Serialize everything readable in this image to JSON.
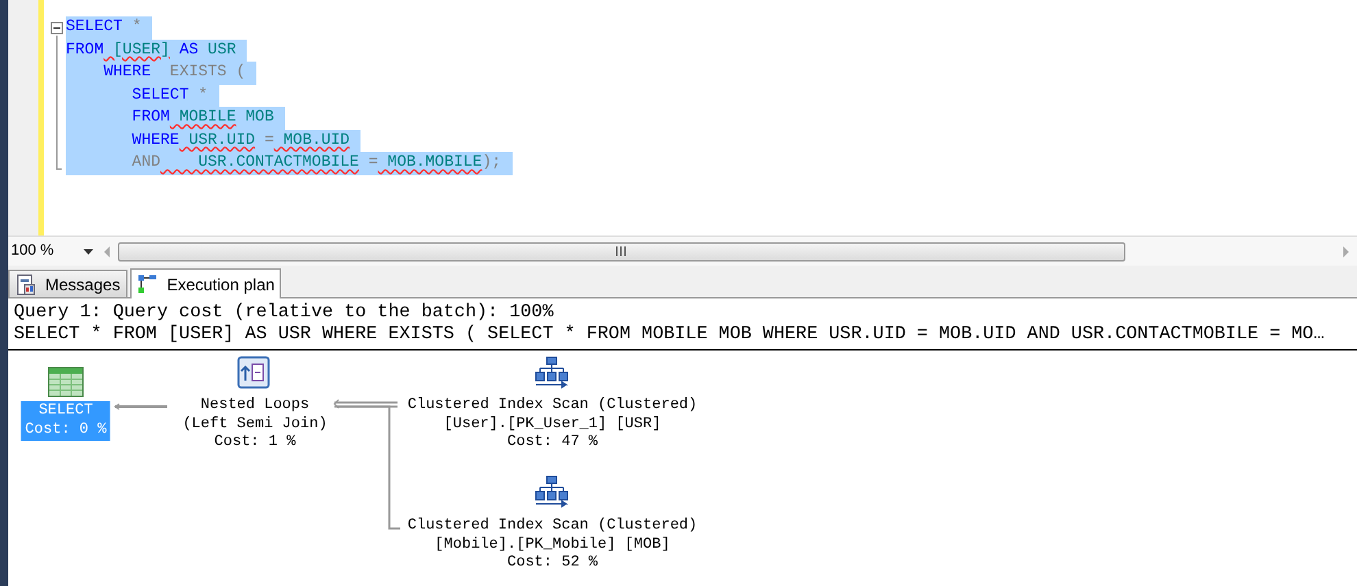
{
  "editor": {
    "selected": true,
    "lines": [
      [
        {
          "text": "SELECT",
          "kind": "keyword"
        },
        {
          "text": " *",
          "kind": "gray"
        }
      ],
      [
        {
          "text": "FROM",
          "kind": "keyword"
        },
        {
          "text": " [USER]",
          "kind": "ident",
          "squiggle": true
        },
        {
          "text": " AS",
          "kind": "keyword"
        },
        {
          "text": " USR",
          "kind": "ident"
        }
      ],
      [
        {
          "text": "    WHERE",
          "kind": "keyword"
        },
        {
          "text": "  EXISTS",
          "kind": "gray"
        },
        {
          "text": " (",
          "kind": "gray"
        }
      ],
      [
        {
          "text": "       SELECT",
          "kind": "keyword"
        },
        {
          "text": " *",
          "kind": "gray"
        }
      ],
      [
        {
          "text": "       FROM",
          "kind": "keyword"
        },
        {
          "text": " MOBILE",
          "kind": "ident",
          "squiggle": true
        },
        {
          "text": " MOB",
          "kind": "ident"
        }
      ],
      [
        {
          "text": "       WHERE",
          "kind": "keyword"
        },
        {
          "text": " USR.UID",
          "kind": "ident",
          "squiggle": true
        },
        {
          "text": " =",
          "kind": "gray"
        },
        {
          "text": " MOB.UID",
          "kind": "ident",
          "squiggle": true
        }
      ],
      [
        {
          "text": "       AND",
          "kind": "gray"
        },
        {
          "text": "    USR.CONTACTMOBILE",
          "kind": "ident",
          "squiggle": true
        },
        {
          "text": " =",
          "kind": "gray"
        },
        {
          "text": " MOB.MOBILE",
          "kind": "ident",
          "squiggle": true
        },
        {
          "text": ");",
          "kind": "gray"
        }
      ]
    ]
  },
  "zoom": {
    "value": "100 %"
  },
  "tabs": [
    {
      "label": "Messages",
      "kind": "messages",
      "selected": false
    },
    {
      "label": "Execution plan",
      "kind": "plan",
      "selected": true
    }
  ],
  "plan": {
    "header": [
      "Query 1: Query cost (relative to the batch): 100%",
      "SELECT * FROM [USER] AS USR WHERE EXISTS ( SELECT * FROM MOBILE MOB WHERE USR.UID = MOB.UID AND USR.CONTACTMOBILE = MO…"
    ],
    "nodes": [
      {
        "kind": "select",
        "selected": true,
        "lines": [
          "SELECT",
          "Cost: 0 %"
        ]
      },
      {
        "kind": "nested_loops",
        "selected": false,
        "lines": [
          "Nested Loops",
          "(Left Semi Join)",
          "Cost: 1 %"
        ]
      },
      {
        "kind": "index_scan",
        "selected": false,
        "lines": [
          "Clustered Index Scan (Clustered)",
          "[User].[PK_User_1] [USR]",
          "Cost: 47 %"
        ]
      },
      {
        "kind": "index_scan",
        "selected": false,
        "lines": [
          "Clustered Index Scan (Clustered)",
          "[Mobile].[PK_Mobile] [MOB]",
          "Cost: 52 %"
        ]
      }
    ]
  }
}
